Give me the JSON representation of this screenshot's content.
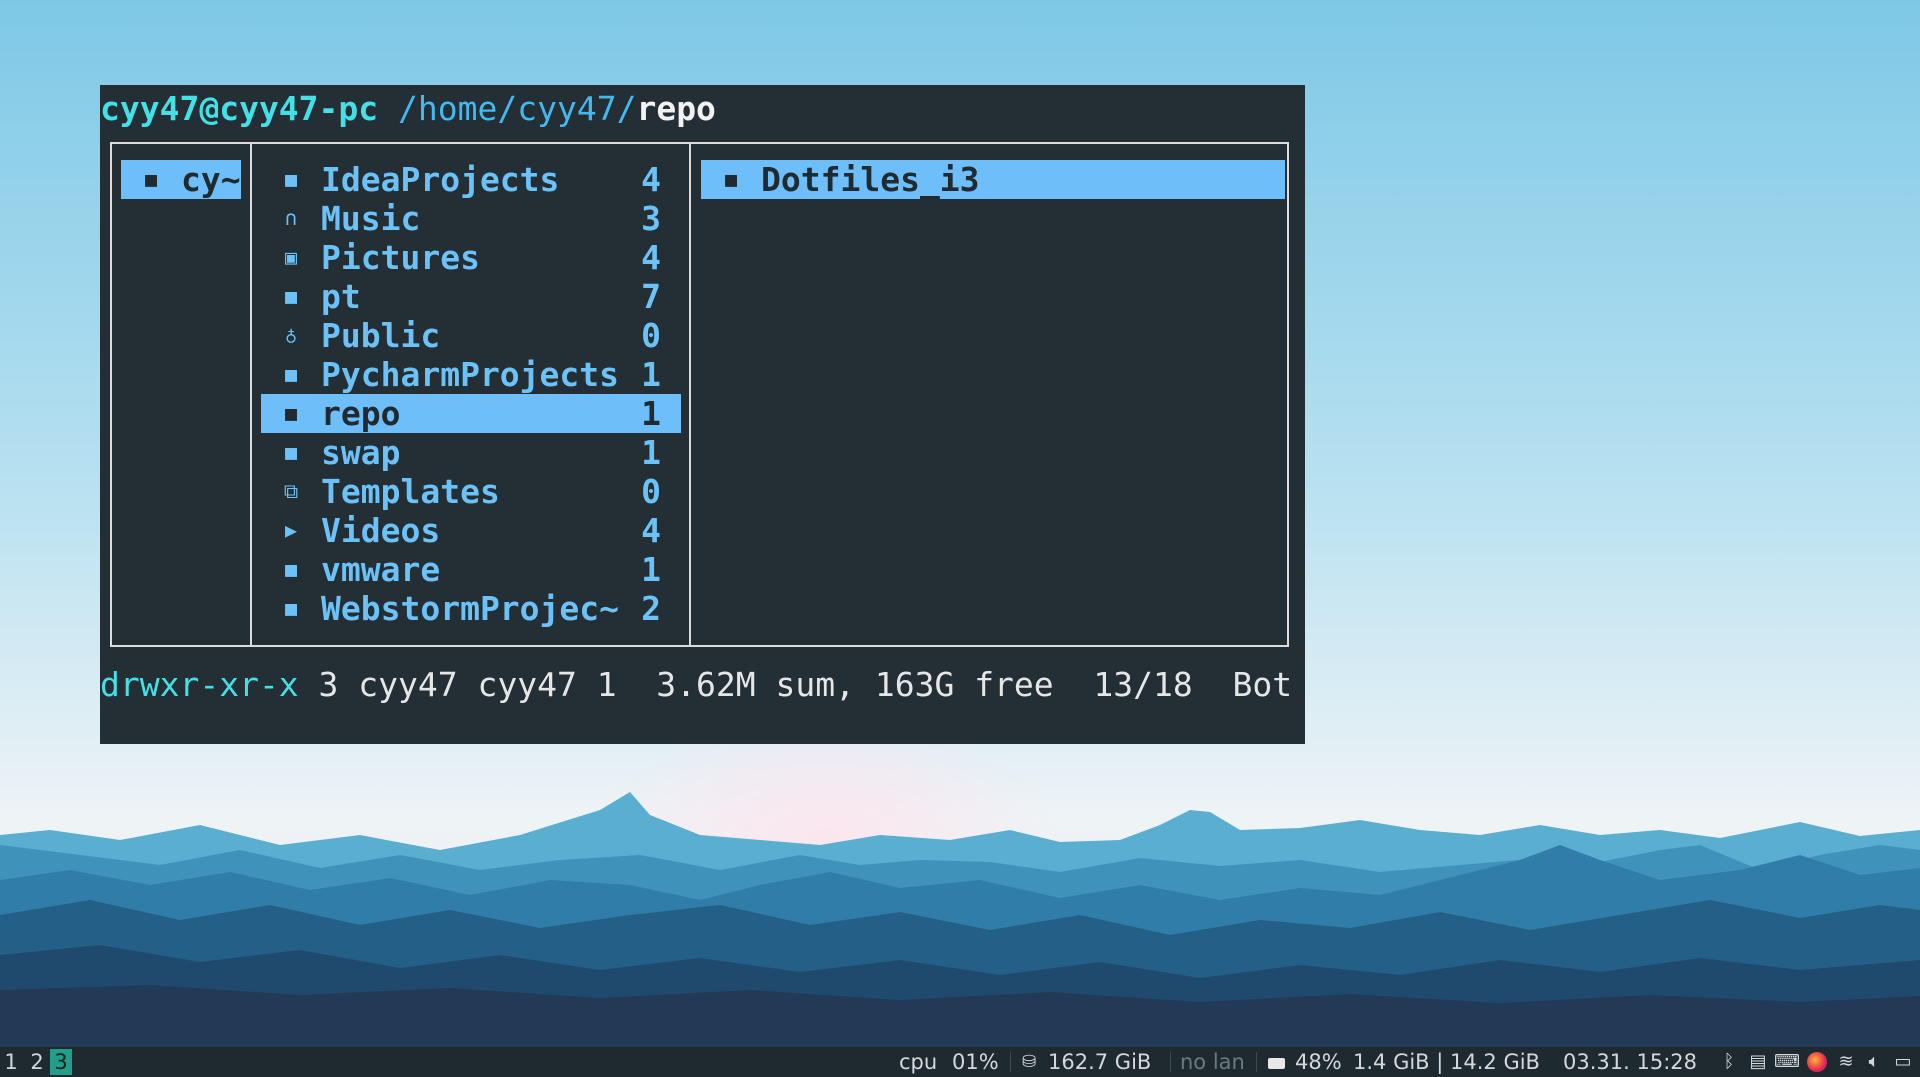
{
  "terminal": {
    "header": {
      "user_host": "cyy47@cyy47-pc",
      "path": "/home/cyy47/",
      "current": "repo"
    },
    "parent_column": {
      "icon": "folder-icon",
      "label": "cy~"
    },
    "entries": [
      {
        "icon": "folder-icon",
        "name": "IdeaProjects",
        "count": "4"
      },
      {
        "icon": "headphones-icon",
        "name": "Music",
        "count": "3"
      },
      {
        "icon": "image-icon",
        "name": "Pictures",
        "count": "4"
      },
      {
        "icon": "folder-icon",
        "name": "pt",
        "count": "7"
      },
      {
        "icon": "share-icon",
        "name": "Public",
        "count": "0"
      },
      {
        "icon": "folder-icon",
        "name": "PycharmProjects",
        "count": "1"
      },
      {
        "icon": "folder-icon",
        "name": "repo",
        "count": "1",
        "selected": true
      },
      {
        "icon": "folder-icon",
        "name": "swap",
        "count": "1"
      },
      {
        "icon": "template-icon",
        "name": "Templates",
        "count": "0"
      },
      {
        "icon": "video-icon",
        "name": "Videos",
        "count": "4"
      },
      {
        "icon": "folder-icon",
        "name": "vmware",
        "count": "1"
      },
      {
        "icon": "folder-icon",
        "name": "WebstormProjec~",
        "count": "2"
      }
    ],
    "preview": [
      {
        "icon": "folder-icon",
        "name": "Dotfiles_i3"
      }
    ],
    "status": {
      "permissions": "drwxr-xr-x",
      "info": " 3 cyy47 cyy47 1  3.62M sum, 163G free  13/18  Bot"
    }
  },
  "taskbar": {
    "workspaces": [
      {
        "label": "1",
        "active": false
      },
      {
        "label": "2",
        "active": false
      },
      {
        "label": "3",
        "active": true
      }
    ],
    "cpu_label": "cpu",
    "cpu_value": "01%",
    "disk_icon": "database-icon",
    "disk": "162.7 GiB",
    "lan": "no lan",
    "battery_icon": "battery-icon",
    "battery": "48%",
    "memory": "1.4 GiB | 14.2 GiB",
    "datetime": "03.31. 15:28",
    "tray_icons": [
      "bluetooth-icon",
      "clipboard-icon",
      "keyboard-icon",
      "firefox-icon",
      "wifi-icon",
      "volume-icon",
      "battery-tray-icon"
    ]
  },
  "colors": {
    "terminal_bg": "#232e35",
    "accent_blue": "#6ebff9",
    "accent_cyan": "#43e0e6",
    "workspace_active": "#20a08a",
    "bar_bg": "#1f2a30"
  }
}
